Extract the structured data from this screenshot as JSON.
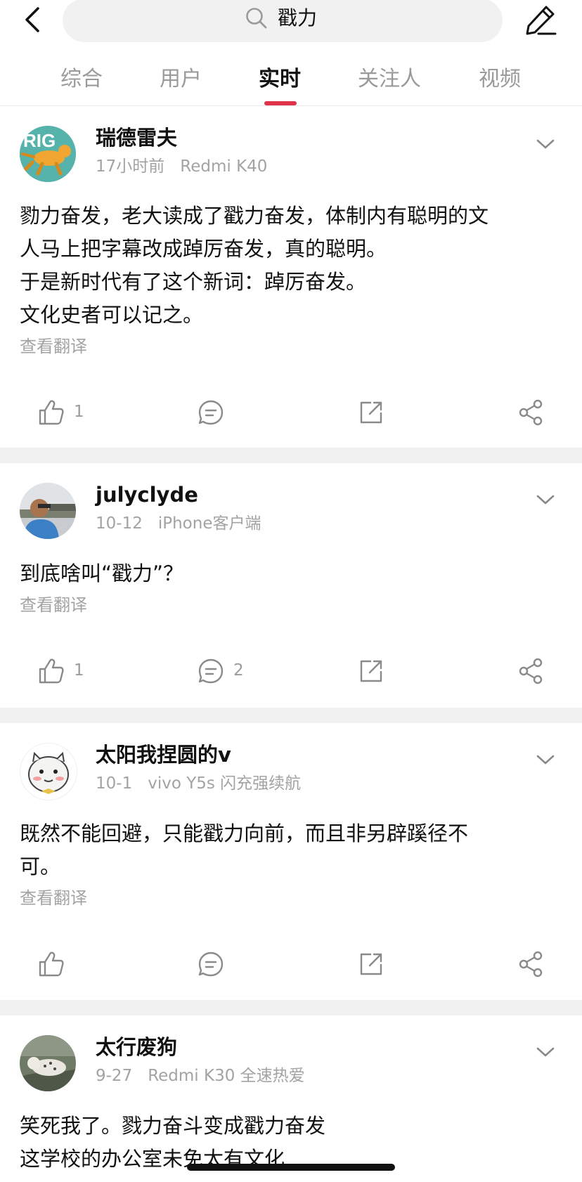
{
  "search": {
    "query": "戳力"
  },
  "tabs": [
    {
      "label": "综合"
    },
    {
      "label": "用户"
    },
    {
      "label": "实时",
      "active": true
    },
    {
      "label": "关注人"
    },
    {
      "label": "视频"
    }
  ],
  "accent_color": "#e0334b",
  "translate_label": "查看翻译",
  "posts": [
    {
      "username": "瑞德雷夫",
      "time": "17小时前",
      "device": "Redmi K40",
      "lines": [
        "勠力奋发，老大读成了戳力奋发，体制内有聪明的文",
        "人马上把字幕改成踔厉奋发，真的聪明。",
        "于是新时代有了这个新词：踔厉奋发。",
        "文化史者可以记之。"
      ],
      "likes": "1",
      "comments": ""
    },
    {
      "username": "julyclyde",
      "time": "10-12",
      "device": "iPhone客户端",
      "lines": [
        "到底啥叫“戳力”？"
      ],
      "likes": "1",
      "comments": "2"
    },
    {
      "username": "太阳我捏圆的v",
      "time": "10-1",
      "device": "vivo Y5s 闪充强续航",
      "lines": [
        "既然不能回避，只能戳力向前，而且非另辟蹊径不",
        "可。"
      ],
      "likes": "",
      "comments": ""
    },
    {
      "username": "太行废狗",
      "time": "9-27",
      "device": "Redmi K30 全速热爱",
      "lines": [
        "笑死我了。戮力奋斗变成戳力奋发",
        "这学校的办公室未免太有文化"
      ],
      "likes": "",
      "comments": ""
    }
  ]
}
